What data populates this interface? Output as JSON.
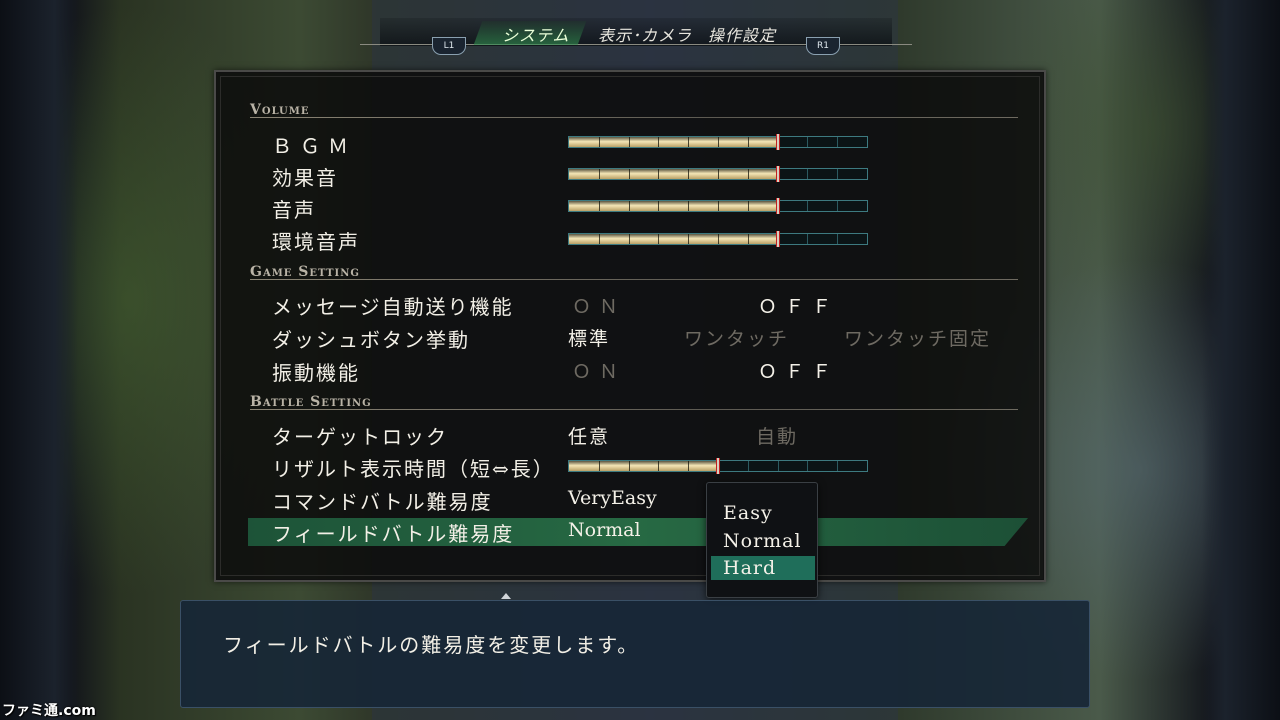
{
  "tabs": {
    "left_shoulder": "L1",
    "right_shoulder": "R1",
    "items": [
      "システム",
      "表示･カメラ",
      "操作設定"
    ],
    "active_index": 0
  },
  "sections": {
    "volume": "Volume",
    "game": "Game Setting",
    "battle": "Battle Setting"
  },
  "volume": {
    "items": [
      {
        "label": "ＢＧＭ",
        "level": 0.7
      },
      {
        "label": "効果音",
        "level": 0.7
      },
      {
        "label": "音声",
        "level": 0.7
      },
      {
        "label": "環境音声",
        "level": 0.7
      }
    ]
  },
  "game_setting": {
    "auto_message": {
      "label": "メッセージ自動送り機能",
      "on": "ＯＮ",
      "off": "ＯＦＦ",
      "selected": "off"
    },
    "dash": {
      "label": "ダッシュボタン挙動",
      "options": [
        "標準",
        "ワンタッチ",
        "ワンタッチ固定"
      ],
      "selected_index": 0
    },
    "vibration": {
      "label": "振動機能",
      "on": "ＯＮ",
      "off": "ＯＦＦ",
      "selected": "off"
    }
  },
  "battle_setting": {
    "target_lock": {
      "label": "ターゲットロック",
      "options": [
        "任意",
        "自動"
      ],
      "selected_index": 0
    },
    "result_time": {
      "label": "リザルト表示時間（短⇔長）",
      "level": 0.5
    },
    "command_difficulty": {
      "label": "コマンドバトル難易度",
      "value": "VeryEasy"
    },
    "field_difficulty": {
      "label": "フィールドバトル難易度",
      "value": "Normal"
    }
  },
  "dropdown": {
    "options": [
      "Easy",
      "Normal",
      "Hard"
    ],
    "highlighted_index": 2
  },
  "description": "フィールドバトルの難易度を変更します。",
  "watermark": "ファミ通.com",
  "colors": {
    "highlight_row": "#2a7a55",
    "dropdown_selected": "#1f6e5a",
    "slider_fill": "#f4e6b6",
    "description_bg": "#162636"
  }
}
